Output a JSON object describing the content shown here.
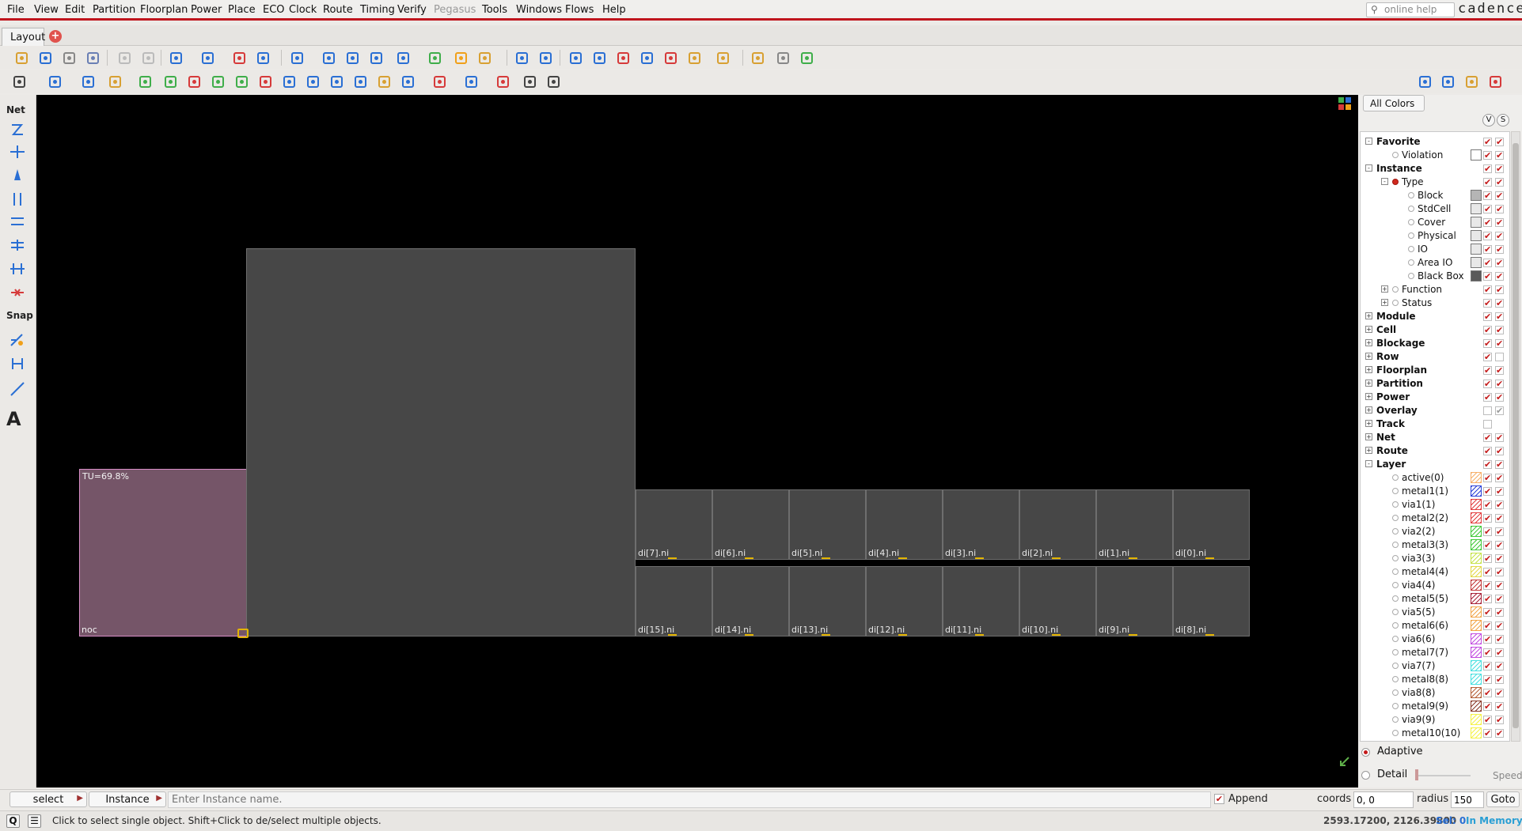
{
  "menu": [
    "File",
    "View",
    "Edit",
    "Partition",
    "Floorplan",
    "Power",
    "Place",
    "ECO",
    "Clock",
    "Route",
    "Timing",
    "Verify",
    "Pegasus",
    "Tools",
    "Windows",
    "Flows",
    "Help"
  ],
  "menu_disabled": "Pegasus",
  "help_placeholder": "online help",
  "brand": "cadence",
  "tab": {
    "label": "Layout",
    "add": "+"
  },
  "left_toolbar": {
    "net": "Net",
    "snap": "Snap",
    "text_tool": "A"
  },
  "canvas": {
    "noc": {
      "name": "noc",
      "utilization": "TU=69.8%"
    },
    "top_row": [
      "di[7].ni",
      "di[6].ni",
      "di[5].ni",
      "di[4].ni",
      "di[3].ni",
      "di[2].ni",
      "di[1].ni",
      "di[0].ni"
    ],
    "bottom_row": [
      "di[15].ni",
      "di[14].ni",
      "di[13].ni",
      "di[12].ni",
      "di[11].ni",
      "di[10].ni",
      "di[9].ni",
      "di[8].ni"
    ]
  },
  "panel": {
    "all_colors": "All Colors",
    "v": "V",
    "s": "S",
    "tree": [
      {
        "label": "Favorite",
        "level": 0,
        "exp": "-",
        "bold": true
      },
      {
        "label": "Violation",
        "level": 1,
        "radio": true,
        "swatch": "#ffffff"
      },
      {
        "label": "Instance",
        "level": 0,
        "exp": "-",
        "bold": true
      },
      {
        "label": "Type",
        "level": 1,
        "exp": "-",
        "radio": true,
        "radio_on": true
      },
      {
        "label": "Block",
        "level": 2,
        "radio": true,
        "swatch": "#b5b5b5"
      },
      {
        "label": "StdCell",
        "level": 2,
        "radio": true,
        "swatch": "#e8e8e8"
      },
      {
        "label": "Cover",
        "level": 2,
        "radio": true,
        "swatch": "#e8e8e8"
      },
      {
        "label": "Physical",
        "level": 2,
        "radio": true,
        "swatch": "#e8e8e8"
      },
      {
        "label": "IO",
        "level": 2,
        "radio": true,
        "swatch": "#e8e8e8"
      },
      {
        "label": "Area IO",
        "level": 2,
        "radio": true,
        "swatch": "#e8e8e8"
      },
      {
        "label": "Black Box",
        "level": 2,
        "radio": true,
        "swatch": "#5a5a5a"
      },
      {
        "label": "Function",
        "level": 1,
        "exp": "+",
        "radio": true
      },
      {
        "label": "Status",
        "level": 1,
        "exp": "+",
        "radio": true
      },
      {
        "label": "Module",
        "level": 0,
        "exp": "+",
        "bold": true
      },
      {
        "label": "Cell",
        "level": 0,
        "exp": "+",
        "bold": true
      },
      {
        "label": "Blockage",
        "level": 0,
        "exp": "+",
        "bold": true
      },
      {
        "label": "Row",
        "level": 0,
        "exp": "+",
        "bold": true,
        "c2": ""
      },
      {
        "label": "Floorplan",
        "level": 0,
        "exp": "+",
        "bold": true
      },
      {
        "label": "Partition",
        "level": 0,
        "exp": "+",
        "bold": true
      },
      {
        "label": "Power",
        "level": 0,
        "exp": "+",
        "bold": true
      },
      {
        "label": "Overlay",
        "level": 0,
        "exp": "+",
        "bold": true,
        "c1": "",
        "c2gray": true
      },
      {
        "label": "Track",
        "level": 0,
        "exp": "+",
        "bold": true,
        "c1": "",
        "nocb2": true
      },
      {
        "label": "Net",
        "level": 0,
        "exp": "+",
        "bold": true
      },
      {
        "label": "Route",
        "level": 0,
        "exp": "+",
        "bold": true
      },
      {
        "label": "Layer",
        "level": 0,
        "exp": "-",
        "bold": true
      },
      {
        "label": "active(0)",
        "level": 1,
        "radio": true,
        "swatch": "#f7b06a",
        "hatch": true
      },
      {
        "label": "metal1(1)",
        "level": 1,
        "radio": true,
        "swatch": "#2a3fd6",
        "hatch": true
      },
      {
        "label": "via1(1)",
        "level": 1,
        "radio": true,
        "swatch": "#e23c3c",
        "hatch": true
      },
      {
        "label": "metal2(2)",
        "level": 1,
        "radio": true,
        "swatch": "#e23c3c",
        "hatch": true
      },
      {
        "label": "via2(2)",
        "level": 1,
        "radio": true,
        "swatch": "#43c93a",
        "hatch": true
      },
      {
        "label": "metal3(3)",
        "level": 1,
        "radio": true,
        "swatch": "#43c93a",
        "hatch": true
      },
      {
        "label": "via3(3)",
        "level": 1,
        "radio": true,
        "swatch": "#c6e34a",
        "hatch": true
      },
      {
        "label": "metal4(4)",
        "level": 1,
        "radio": true,
        "swatch": "#e3d84a",
        "hatch": true
      },
      {
        "label": "via4(4)",
        "level": 1,
        "radio": true,
        "swatch": "#c23a3a",
        "hatch": true
      },
      {
        "label": "metal5(5)",
        "level": 1,
        "radio": true,
        "swatch": "#a8243a",
        "hatch": true
      },
      {
        "label": "via5(5)",
        "level": 1,
        "radio": true,
        "swatch": "#f2a54a",
        "hatch": true
      },
      {
        "label": "metal6(6)",
        "level": 1,
        "radio": true,
        "swatch": "#f2a54a",
        "hatch": true
      },
      {
        "label": "via6(6)",
        "level": 1,
        "radio": true,
        "swatch": "#c34ee0",
        "hatch": true
      },
      {
        "label": "metal7(7)",
        "level": 1,
        "radio": true,
        "swatch": "#c34ee0",
        "hatch": true
      },
      {
        "label": "via7(7)",
        "level": 1,
        "radio": true,
        "swatch": "#4ae0e0",
        "hatch": true
      },
      {
        "label": "metal8(8)",
        "level": 1,
        "radio": true,
        "swatch": "#4ae0e0",
        "hatch": true
      },
      {
        "label": "via8(8)",
        "level": 1,
        "radio": true,
        "swatch": "#b5603a",
        "hatch": true
      },
      {
        "label": "metal9(9)",
        "level": 1,
        "radio": true,
        "swatch": "#8a3a2a",
        "hatch": true
      },
      {
        "label": "via9(9)",
        "level": 1,
        "radio": true,
        "swatch": "#f5f24a",
        "hatch": true
      },
      {
        "label": "metal10(10)",
        "level": 1,
        "radio": true,
        "swatch": "#f5f24a",
        "hatch": true
      }
    ],
    "adaptive": "Adaptive",
    "detail": "Detail",
    "speed": "Speed"
  },
  "cmd": {
    "mode": "select",
    "object": "Instance",
    "placeholder": "Enter Instance name.",
    "append": "Append",
    "coords_label": "coords",
    "coords_value": "0, 0",
    "radius_label": "radius",
    "radius_value": "150",
    "goto": "Goto"
  },
  "status": {
    "q": "Q",
    "message": "Click to select single object. Shift+Click to de/select multiple objects.",
    "coords": "2593.17200, 2126.39800",
    "sel": "Sel: 0",
    "memory": "In Memory"
  }
}
